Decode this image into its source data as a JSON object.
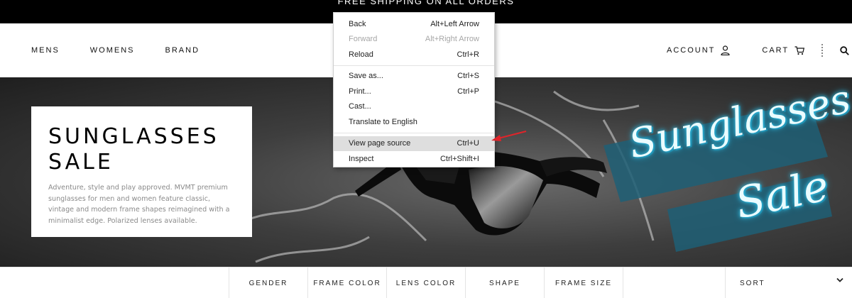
{
  "banner": {
    "text": "FREE SHIPPING ON ALL ORDERS"
  },
  "nav": {
    "left": [
      {
        "label": "MENS"
      },
      {
        "label": "WOMENS"
      },
      {
        "label": "BRAND"
      }
    ],
    "account_label": "ACCOUNT",
    "cart_label": "CART",
    "icons": [
      "user-icon",
      "cart-icon",
      "search-icon"
    ]
  },
  "hero": {
    "title_line1": "SUNGLASSES",
    "title_line2": "SALE",
    "description": "Adventure, style and play approved. MVMT premium sunglasses for men and women feature classic, vintage and modern frame shapes reimagined with a minimalist edge. Polarized lenses available.",
    "script_line1": "Sunglasses",
    "script_line2": "Sale"
  },
  "filters": [
    {
      "label": "GENDER"
    },
    {
      "label": "FRAME COLOR"
    },
    {
      "label": "LENS COLOR"
    },
    {
      "label": "SHAPE"
    },
    {
      "label": "FRAME SIZE"
    }
  ],
  "sort": {
    "label": "SORT",
    "icon": "chevron-down-icon"
  },
  "context_menu": {
    "items": [
      {
        "label": "Back",
        "shortcut": "Alt+Left Arrow"
      },
      {
        "label": "Forward",
        "shortcut": "Alt+Right Arrow",
        "disabled": true
      },
      {
        "label": "Reload",
        "shortcut": "Ctrl+R"
      },
      {
        "label": "Save as...",
        "shortcut": "Ctrl+S"
      },
      {
        "label": "Print...",
        "shortcut": "Ctrl+P"
      },
      {
        "label": "Cast...",
        "shortcut": ""
      },
      {
        "label": "Translate to English",
        "shortcut": ""
      },
      {
        "label": "View page source",
        "shortcut": "Ctrl+U",
        "highlighted": true
      },
      {
        "label": "Inspect",
        "shortcut": "Ctrl+Shift+I"
      }
    ]
  },
  "colors": {
    "banner_bg": "#000000",
    "neon_cyan": "#34c4e8",
    "neon_panel": "#1f5f75",
    "annotation_arrow": "#e0242a",
    "menu_highlight": "#dedede"
  }
}
